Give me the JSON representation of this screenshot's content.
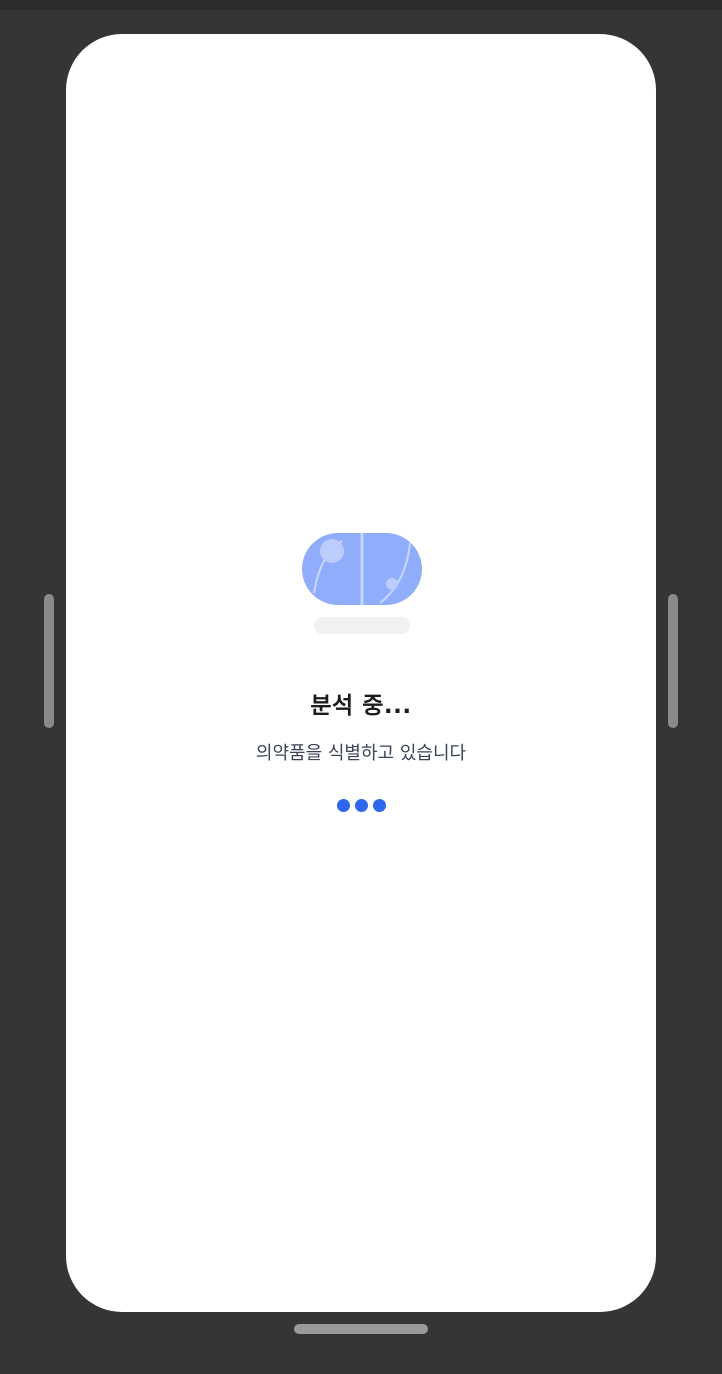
{
  "analysis": {
    "title": "분석 중...",
    "subtitle": "의약품을 식별하고 있습니다"
  },
  "icons": {
    "pill": "pill-icon",
    "loading": "loading-dots-icon"
  },
  "colors": {
    "pill_fill": "#90adfc",
    "accent": "#2f66ee",
    "shadow": "#f0f1f3",
    "title_text": "#1c1c1e",
    "subtitle_text": "#3a4458",
    "background": "#353535"
  }
}
